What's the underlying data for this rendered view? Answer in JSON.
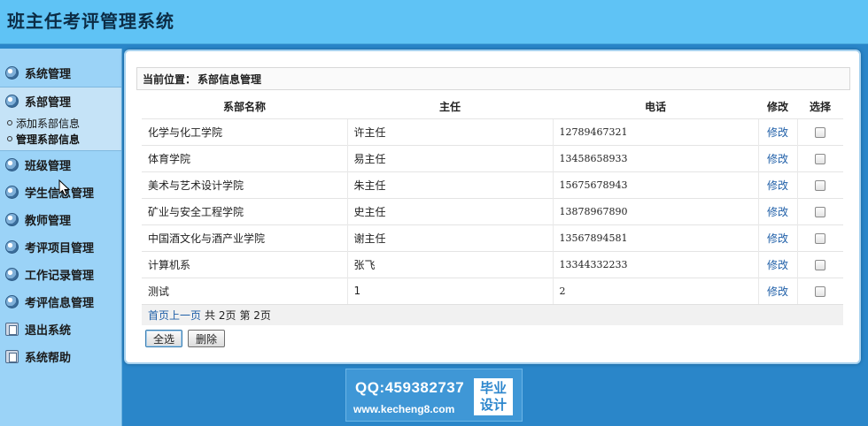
{
  "app": {
    "title": "班主任考评管理系统"
  },
  "sidebar": {
    "items": [
      {
        "label": "系统管理",
        "icon": "disc-icon"
      },
      {
        "label": "系部管理",
        "icon": "disc-icon",
        "expanded": true,
        "children": [
          {
            "label": "添加系部信息",
            "active": false
          },
          {
            "label": "管理系部信息",
            "active": true
          }
        ]
      },
      {
        "label": "班级管理",
        "icon": "disc-icon"
      },
      {
        "label": "学生信息管理",
        "icon": "disc-icon"
      },
      {
        "label": "教师管理",
        "icon": "disc-icon"
      },
      {
        "label": "考评项目管理",
        "icon": "disc-icon"
      },
      {
        "label": "工作记录管理",
        "icon": "disc-icon"
      },
      {
        "label": "考评信息管理",
        "icon": "disc-icon"
      },
      {
        "label": "退出系统",
        "icon": "door-icon"
      },
      {
        "label": "系统帮助",
        "icon": "door-icon"
      }
    ]
  },
  "breadcrumb": {
    "label": "当前位置：",
    "current": "系部信息管理"
  },
  "table": {
    "headers": [
      "系部名称",
      "主任",
      "电话",
      "修改",
      "选择"
    ],
    "rows": [
      {
        "name": "化学与化工学院",
        "director": "许主任",
        "phone": "12789467321",
        "edit": "修改"
      },
      {
        "name": "体育学院",
        "director": "易主任",
        "phone": "13458658933",
        "edit": "修改"
      },
      {
        "name": "美术与艺术设计学院",
        "director": "朱主任",
        "phone": "15675678943",
        "edit": "修改"
      },
      {
        "name": "矿业与安全工程学院",
        "director": "史主任",
        "phone": "13878967890",
        "edit": "修改"
      },
      {
        "name": "中国酒文化与酒产业学院",
        "director": "谢主任",
        "phone": "13567894581",
        "edit": "修改"
      },
      {
        "name": "计算机系",
        "director": "张飞",
        "phone": "13344332233",
        "edit": "修改"
      },
      {
        "name": "测试",
        "director": "1",
        "phone": "2",
        "edit": "修改"
      }
    ]
  },
  "pager": {
    "first": "首页",
    "prev": "上一页",
    "total": "共 2页",
    "current": "第 2页"
  },
  "buttons": {
    "select_all": "全选",
    "delete": "删除"
  },
  "ad": {
    "qq": "QQ:459382737",
    "url": "www.kecheng8.com",
    "badge_line1": "毕业",
    "badge_line2": "设计"
  },
  "colors": {
    "header_bg": "#5fc3f5",
    "sidebar_bg": "#9bd3f7",
    "page_bg": "#2a86c9",
    "link": "#1f5fa8"
  }
}
